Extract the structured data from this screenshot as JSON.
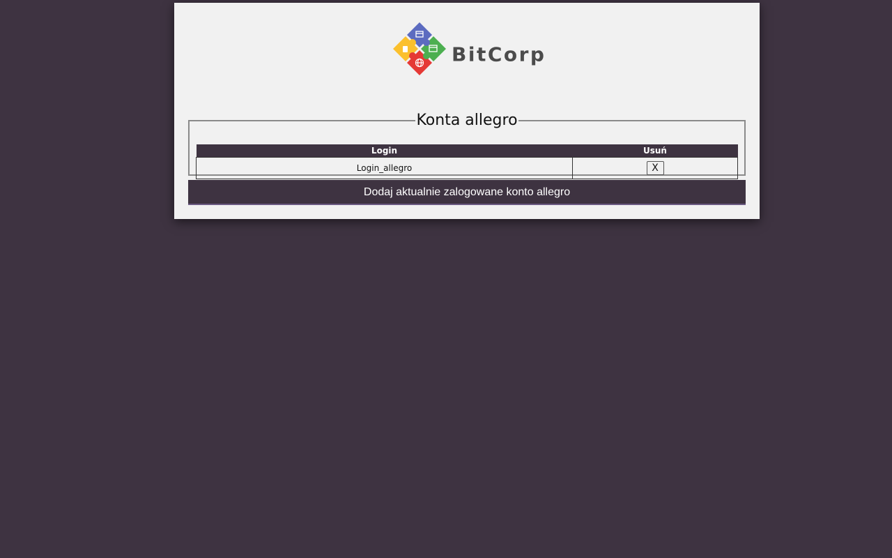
{
  "logo": {
    "brand": "BitCorp",
    "icons": [
      "box-icon",
      "card-icon",
      "browser-icon",
      "globe-icon"
    ],
    "colors": {
      "blue": "#5c6bc0",
      "yellow": "#fbc02d",
      "green": "#4caf50",
      "red": "#e53935",
      "text": "#4b4b4b"
    }
  },
  "accounts": {
    "title": "Konta allegro",
    "columns": [
      "Login",
      "Usuń"
    ],
    "rows": [
      {
        "login": "Login_allegro",
        "delete_label": "X"
      }
    ]
  },
  "add_button_label": "Dodaj aktualnie zalogowane konto allegro",
  "theme": {
    "background": "#3e3341",
    "panel": "#f1f1f1",
    "accent_border": "#6b5a82"
  }
}
